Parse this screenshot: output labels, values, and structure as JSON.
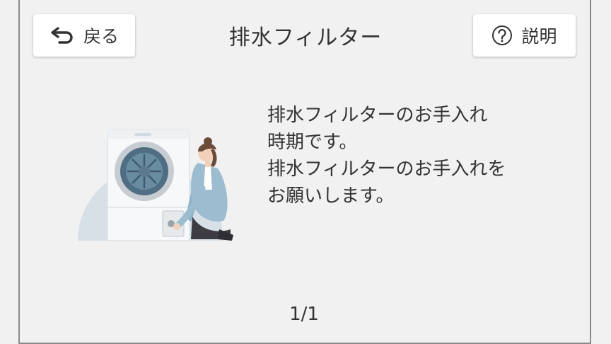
{
  "header": {
    "back_label": "戻る",
    "title": "排水フィルター",
    "help_label": "説明"
  },
  "message": {
    "lines": [
      "排水フィルターのお手入れ",
      "時期です。",
      "排水フィルターのお手入れを",
      "お願いします。"
    ]
  },
  "pager": {
    "text": "1/1"
  },
  "icons": {
    "back": "return-arrow-icon",
    "help": "question-circle-icon",
    "illustration": "washing-machine-filter-cleaning-illustration"
  },
  "colors": {
    "background": "#f1f1f1",
    "button": "#ffffff",
    "text": "#333333",
    "illustration_circle": "#d7e0e7",
    "person_shirt": "#9cbdd0"
  }
}
